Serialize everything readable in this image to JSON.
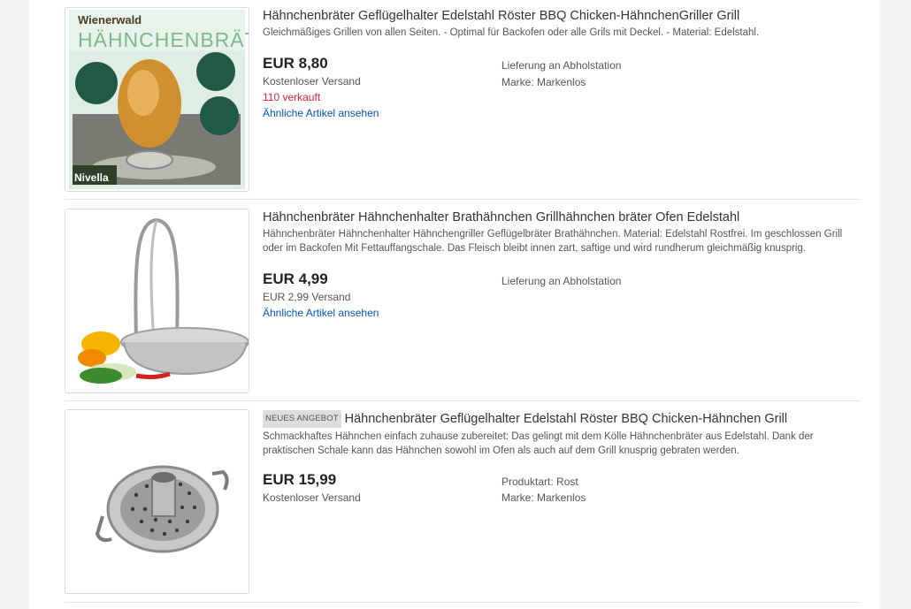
{
  "listings": [
    {
      "image_label": "Hähnchenbräter product box",
      "image_text": {
        "brand": "Wienerwald",
        "product": "HÄHNCHENBRÄTER",
        "maker": "Nivella"
      },
      "badge": "",
      "title": "Hähnchenbräter Geflügelhalter Edelstahl Röster BBQ Chicken-HähnchenGriller Grill",
      "description": "Gleichmäßiges Grillen von allen Seiten. - Optimal für Backofen oder alle Grils mit Deckel. - Material: Edelstahl.",
      "price": "EUR 8,80",
      "shipping": "Kostenloser Versand",
      "sold": "110 verkauft",
      "similar": "Ähnliche Artikel ansehen",
      "right": [
        "Lieferung an Abholstation",
        "Marke: Markenlos"
      ]
    },
    {
      "image_label": "Chrome chicken roaster stand with peppers",
      "badge": "",
      "title": "Hähnchenbräter Hähnchenhalter Brathähnchen Grillhähnchen bräter Ofen Edelstahl",
      "description": "Hähnchenbräter Hähnchenhalter Hähnchengriller Geflügelbräter Brathähnchen. Material: Edelstahl Rostfrei. Im geschlossen Grill oder im Backofen Mit Fettauffangschale. Das Fleisch bleibt innen zart, saftige und wird rundherum gleichmäßig knusprig.",
      "price": "EUR 4,99",
      "shipping": "EUR 2,99 Versand",
      "sold": "",
      "similar": "Ähnliche Artikel ansehen",
      "right": [
        "Lieferung an Abholstation"
      ]
    },
    {
      "image_label": "Stainless steel roaster pan with handles",
      "badge": "NEUES ANGEBOT",
      "title": "Hähnchenbräter Geflügelhalter Edelstahl Röster BBQ Chicken-Hähnchen Grill",
      "description": "Schmackhaftes Hähnchen einfach zuhause zubereitet: Das gelingt mit dem Kölle Hähnchenbräter aus Edelstahl. Dank der praktischen Schale kann das Hähnchen sowohl im Ofen als auch auf dem Grill knusprig gebraten werden.",
      "price": "EUR 15,99",
      "shipping": "Kostenloser Versand",
      "sold": "",
      "similar": "",
      "right": [
        "Produktart: Rost",
        "Marke: Markenlos"
      ]
    }
  ],
  "colors": {
    "link": "#0654ba",
    "sold": "#dd1e31",
    "badge_bg": "#dddddd"
  }
}
